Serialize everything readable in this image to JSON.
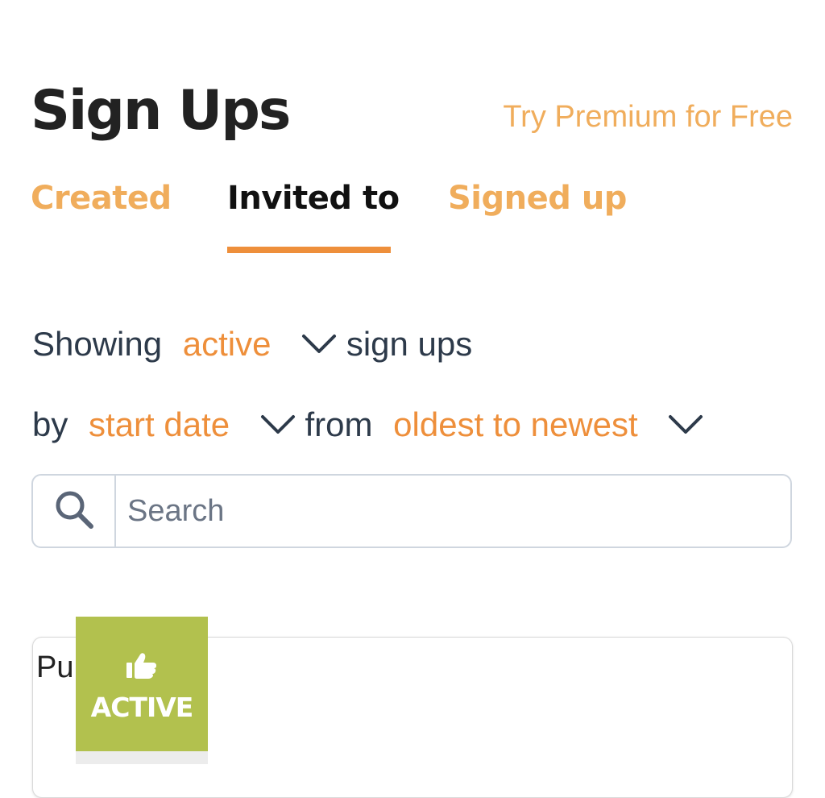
{
  "header": {
    "title": "Sign Ups",
    "premium_link": "Try Premium for Free"
  },
  "tabs": [
    {
      "label": "Created",
      "selected": false
    },
    {
      "label": "Invited to",
      "selected": true
    },
    {
      "label": "Signed up",
      "selected": false
    }
  ],
  "filters": {
    "showing_label": "Showing",
    "status_value": "active",
    "suffix_label": "sign ups",
    "by_label": "by",
    "sort_field_value": "start date",
    "from_label": "from",
    "sort_order_value": "oldest to newest",
    "dropdown_icon": "chevron-down-icon"
  },
  "search": {
    "placeholder": "Search",
    "value": "",
    "icon": "search-icon"
  },
  "card": {
    "title_visible_fragment": "Pu",
    "badge": {
      "label": "ACTIVE",
      "icon": "thumbs-up-icon",
      "color": "#b2c14e"
    }
  },
  "colors": {
    "accent": "#ee8f3b",
    "accent_light": "#f0ad5c",
    "text_dark": "#222222",
    "text_body": "#2d3a4a",
    "border": "#cfd6df"
  }
}
